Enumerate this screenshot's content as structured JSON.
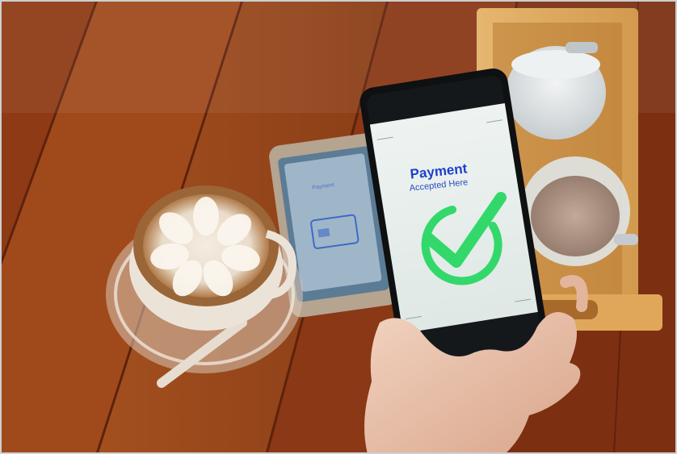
{
  "phone_screen": {
    "title": "Payment",
    "subtitle": "Accepted Here"
  },
  "background_phone": {
    "title": "Payment"
  },
  "colors": {
    "table_wood": "#8a3a14",
    "check_green": "#33d86a",
    "text_blue": "#1d3fc9"
  },
  "icons": [
    "checkmark-circle-icon"
  ]
}
